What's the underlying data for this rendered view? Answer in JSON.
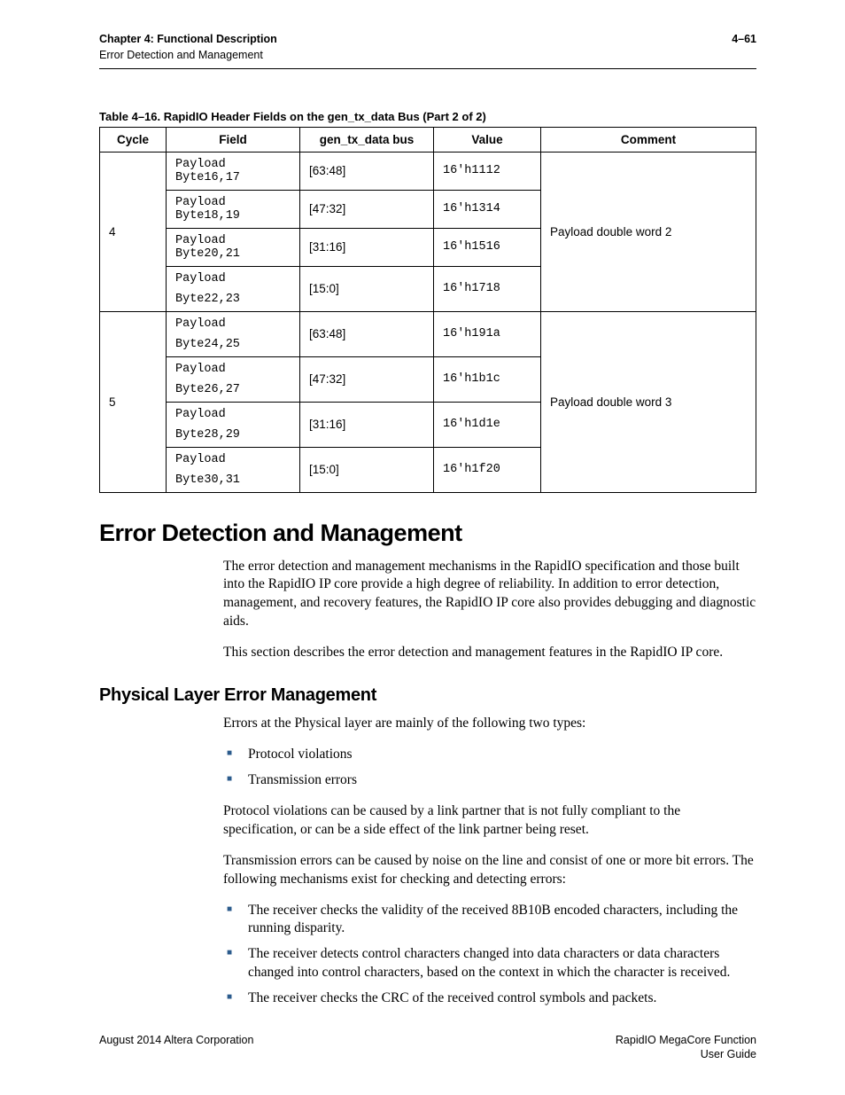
{
  "header": {
    "chapter_line": "Chapter 4:  Functional Description",
    "subtitle": "Error Detection and Management",
    "page_no": "4–61"
  },
  "table": {
    "caption": "Table 4–16.  RapidIO Header Fields on the gen_tx_data Bus  (Part 2 of 2)",
    "cols": {
      "c0": "Cycle",
      "c1": "Field",
      "c2": "gen_tx_data bus",
      "c3": "Value",
      "c4": "Comment"
    },
    "groups": [
      {
        "cycle": "4",
        "comment": "Payload double word 2",
        "rows": [
          {
            "field_a": "Payload",
            "field_b": "Byte16,17",
            "bus": "[63:48]",
            "value": "16'h1112"
          },
          {
            "field_a": "Payload",
            "field_b": "Byte18,19",
            "bus": "[47:32]",
            "value": "16'h1314"
          },
          {
            "field_a": "Payload",
            "field_b": "Byte20,21",
            "bus": "[31:16]",
            "value": "16'h1516"
          },
          {
            "field_a": "Payload",
            "field_b": "Byte22,23",
            "bus": "[15:0]",
            "value": "16'h1718"
          }
        ]
      },
      {
        "cycle": "5",
        "comment": "Payload double word 3",
        "rows": [
          {
            "field_a": "Payload",
            "field_b": "Byte24,25",
            "bus": "[63:48]",
            "value": "16'h191a"
          },
          {
            "field_a": "Payload",
            "field_b": "Byte26,27",
            "bus": "[47:32]",
            "value": "16'h1b1c"
          },
          {
            "field_a": "Payload",
            "field_b": "Byte28,29",
            "bus": "[31:16]",
            "value": "16'h1d1e"
          },
          {
            "field_a": "Payload",
            "field_b": "Byte30,31",
            "bus": "[15:0]",
            "value": "16'h1f20"
          }
        ]
      }
    ]
  },
  "section": {
    "h1": "Error Detection and Management",
    "p1": "The error detection and management mechanisms in the RapidIO specification and those built into the RapidIO IP core provide a high degree of reliability. In addition to error detection, management, and recovery features, the RapidIO IP core also provides debugging and diagnostic aids.",
    "p2": "This section describes the error detection and management features in the RapidIO IP core.",
    "h2": "Physical Layer Error Management",
    "p3": "Errors at the Physical layer are mainly of the following two types:",
    "list1": {
      "i0": "Protocol violations",
      "i1": "Transmission errors"
    },
    "p4": "Protocol violations can be caused by a link partner that is not fully compliant to the specification, or can be a side effect of the link partner being reset.",
    "p5": "Transmission errors can be caused by noise on the line and consist of one or more bit errors. The following mechanisms exist for checking and detecting errors:",
    "list2": {
      "i0": "The receiver checks the validity of the received 8B10B encoded characters, including the running disparity.",
      "i1": "The receiver detects control characters changed into data characters or data characters changed into control characters, based on the context in which the character is received.",
      "i2": "The receiver checks the CRC of the received control symbols and packets."
    }
  },
  "footer": {
    "left": "August 2014   Altera Corporation",
    "right_a": "RapidIO MegaCore Function",
    "right_b": "User Guide"
  }
}
